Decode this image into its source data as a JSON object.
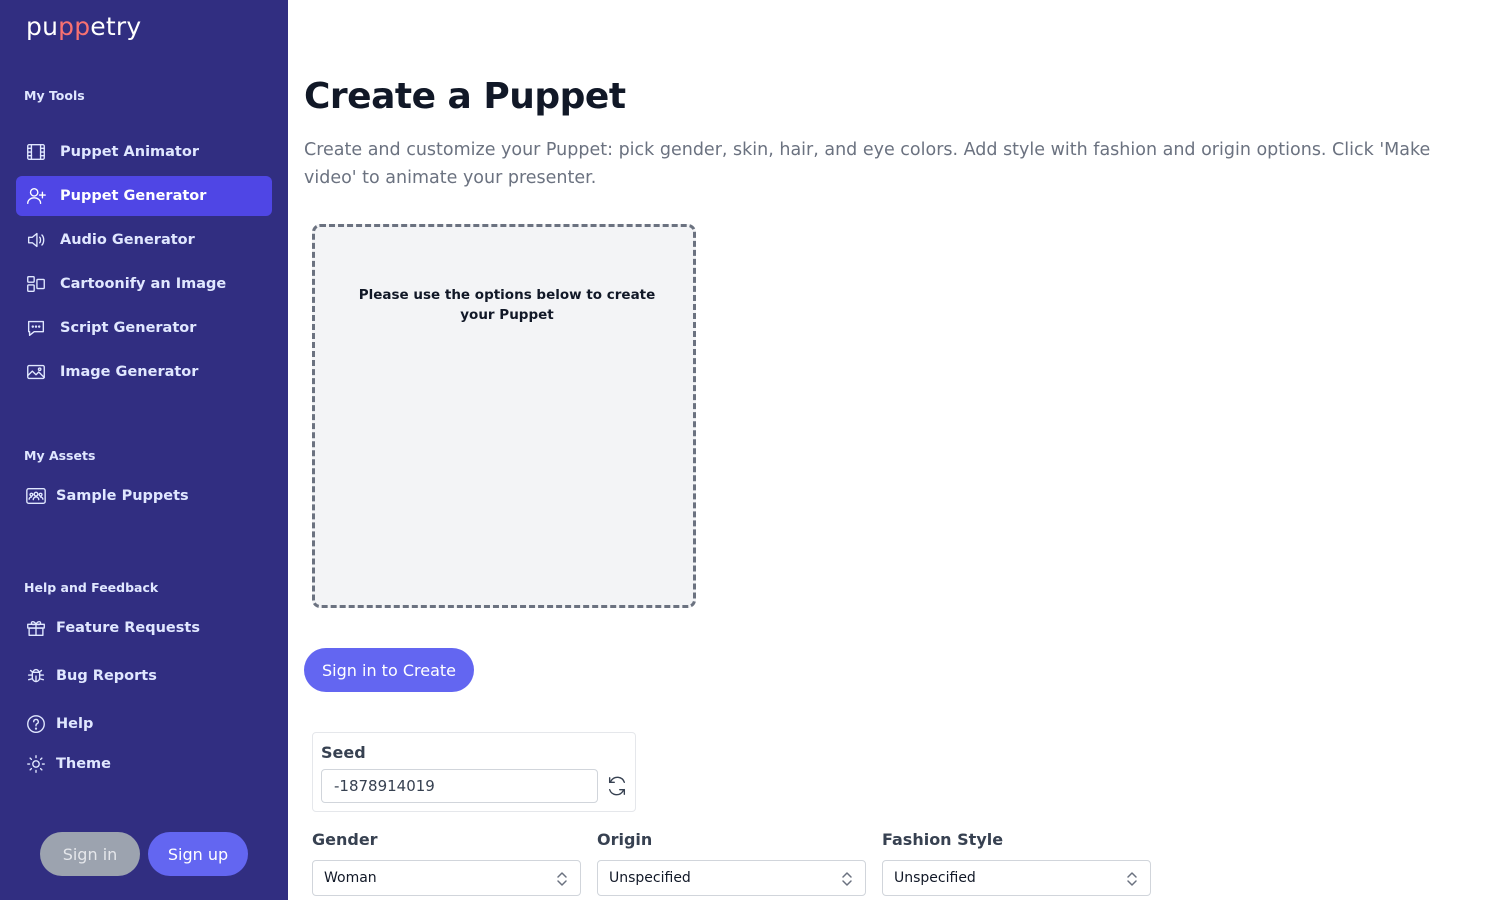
{
  "brand": {
    "logo_pre": "pu",
    "logo_mid": "pp",
    "logo_post": "etry"
  },
  "sidebar": {
    "tools_title": "My Tools",
    "tools": [
      {
        "label": "Puppet Animator",
        "icon": "film-icon"
      },
      {
        "label": "Puppet Generator",
        "icon": "user-plus-icon",
        "active": true
      },
      {
        "label": "Audio Generator",
        "icon": "speaker-icon"
      },
      {
        "label": "Cartoonify an Image",
        "icon": "layout-icon"
      },
      {
        "label": "Script Generator",
        "icon": "chat-bubble-icon"
      },
      {
        "label": "Image Generator",
        "icon": "photo-icon"
      }
    ],
    "assets_title": "My Assets",
    "assets": [
      {
        "label": "Sample Puppets",
        "icon": "group-icon"
      }
    ],
    "help_title": "Help and Feedback",
    "help": [
      {
        "label": "Feature Requests",
        "icon": "gift-icon"
      },
      {
        "label": "Bug Reports",
        "icon": "bug-icon"
      },
      {
        "label": "Help",
        "icon": "question-icon"
      },
      {
        "label": "Theme",
        "icon": "sun-icon"
      }
    ],
    "signin_label": "Sign in",
    "signup_label": "Sign up"
  },
  "main": {
    "title": "Create a Puppet",
    "description": "Create and customize your Puppet: pick gender, skin, hair, and eye colors. Add style with fashion and origin options. Click 'Make video' to animate your presenter.",
    "preview_text": "Please use the options below to create your Puppet",
    "create_button": "Sign in to Create",
    "seed": {
      "label": "Seed",
      "value": "-1878914019"
    },
    "fields": [
      {
        "label": "Gender",
        "value": "Woman"
      },
      {
        "label": "Origin",
        "value": "Unspecified"
      },
      {
        "label": "Fashion Style",
        "value": "Unspecified"
      }
    ]
  },
  "colors": {
    "sidebar_bg": "#312e81",
    "active_bg": "#4f46e5",
    "accent": "#6366f1"
  }
}
